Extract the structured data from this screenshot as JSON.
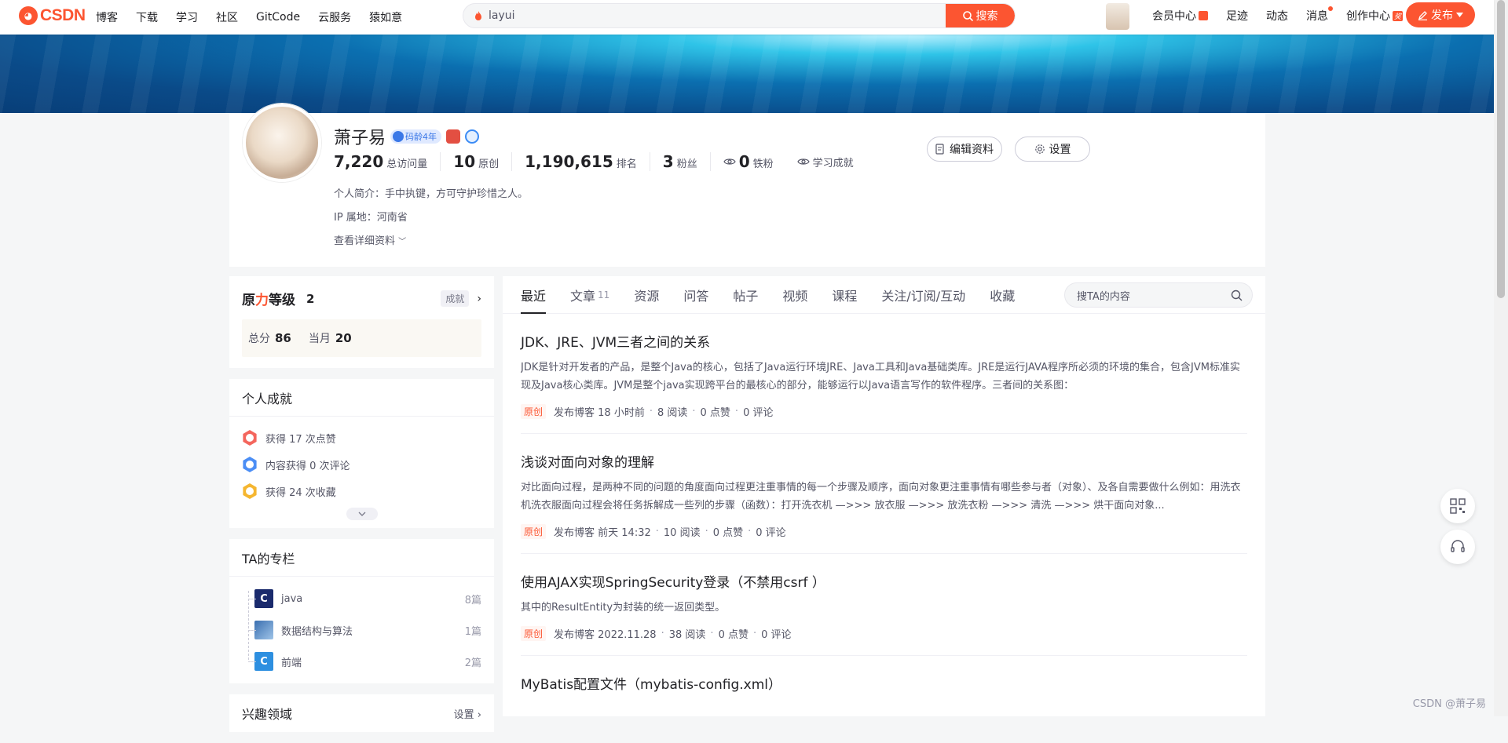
{
  "brand": {
    "logo_text": "CSDN",
    "accent": "#fc5531"
  },
  "topnav": {
    "items": [
      "博客",
      "下载",
      "学习",
      "社区",
      "GitCode",
      "云服务",
      "猿如意"
    ],
    "search_value": "layui",
    "search_button": "搜索",
    "right_items": {
      "vip": "会员中心",
      "footprint": "足迹",
      "activity": "动态",
      "messages": "消息",
      "creator": "创作中心",
      "creator_badge": "奖"
    },
    "publish": "发布"
  },
  "profile": {
    "username": "萧子易",
    "age_badge": "码龄4年",
    "stats": [
      {
        "value": "7,220",
        "label": "总访问量"
      },
      {
        "value": "10",
        "label": "原创"
      },
      {
        "value": "1,190,615",
        "label": "排名"
      },
      {
        "value": "3",
        "label": "粉丝"
      },
      {
        "value": "0",
        "label": "铁粉"
      }
    ],
    "achievement_link": "学习成就",
    "intro": "个人简介：手中执键，方可守护珍惜之人。",
    "ip": "IP 属地：河南省",
    "more": "查看详细资料",
    "edit_button": "编辑资料",
    "settings_button": "设置"
  },
  "level": {
    "title_a": "原",
    "title_red": "力",
    "title_b": "等级",
    "level": "2",
    "achievement_tag": "成就",
    "total_label": "总分",
    "total": "86",
    "month_label": "当月",
    "month": "20"
  },
  "achievements": {
    "title": "个人成就",
    "items": [
      {
        "text": "获得 17 次点赞",
        "color": "#f4665d"
      },
      {
        "text": "内容获得 0 次评论",
        "color": "#4b8ef5"
      },
      {
        "text": "获得 24 次收藏",
        "color": "#f5b630"
      }
    ]
  },
  "columns": {
    "title": "TA的专栏",
    "items": [
      {
        "name": "java",
        "count": "8篇"
      },
      {
        "name": "数据结构与算法",
        "count": "1篇"
      },
      {
        "name": "前端",
        "count": "2篇"
      }
    ]
  },
  "interests": {
    "title": "兴趣领域",
    "action": "设置"
  },
  "tabs": {
    "items": [
      "最近",
      "文章",
      "资源",
      "问答",
      "帖子",
      "视频",
      "课程",
      "关注/订阅/互动",
      "收藏"
    ],
    "article_count": "11",
    "search_placeholder": "搜TA的内容"
  },
  "articles": [
    {
      "title": "JDK、JRE、JVM三者之间的关系",
      "summary": "JDK是针对开发者的产品，是整个Java的核心，包括了Java运行环境JRE、Java工具和Java基础类库。JRE是运行JAVA程序所必须的环境的集合，包含JVM标准实现及Java核心类库。JVM是整个java实现跨平台的最核心的部分，能够运行以Java语言写作的软件程序。三者间的关系图：",
      "tag": "原创",
      "time": "发布博客 18 小时前",
      "reads": "8 阅读",
      "likes": "0 点赞",
      "comments": "0 评论"
    },
    {
      "title": "浅谈对面向对象的理解",
      "summary": "对比面向过程，是两种不同的问题的角度面向过程更注重事情的每一个步骤及顺序，面向对象更注重事情有哪些参与者（对象）、及各自需要做什么例如：用洗衣机洗衣服面向过程会将任务拆解成一些列的步骤（函数）：打开洗衣机 —>>> 放衣服 —>>> 放洗衣粉 —>>> 清洗 —>>> 烘干面向对象...",
      "tag": "原创",
      "time": "发布博客 前天 14:32",
      "reads": "10 阅读",
      "likes": "0 点赞",
      "comments": "0 评论"
    },
    {
      "title": "使用AJAX实现SpringSecurity登录（不禁用csrf ）",
      "summary": "其中的ResultEntity为封装的统一返回类型。",
      "tag": "原创",
      "time": "发布博客 2022.11.28",
      "reads": "38 阅读",
      "likes": "0 点赞",
      "comments": "0 评论"
    },
    {
      "title": "MyBatis配置文件（mybatis-config.xml）"
    }
  ],
  "watermark": "CSDN @萧子易"
}
